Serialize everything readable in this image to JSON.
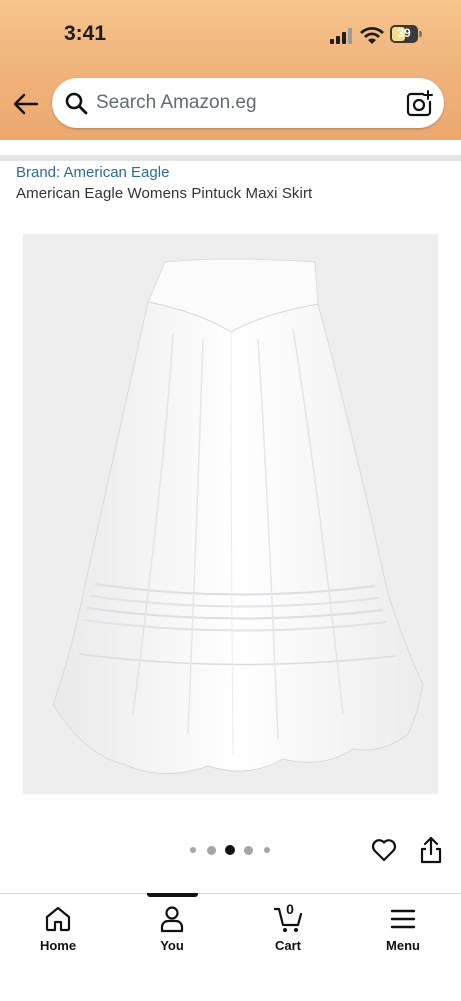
{
  "status_bar": {
    "time": "3:41",
    "battery_level": "39"
  },
  "search": {
    "placeholder": "Search Amazon.eg"
  },
  "product": {
    "brand_link": "Brand: American Eagle",
    "title": "American Eagle Womens Pintuck Maxi Skirt"
  },
  "gallery": {
    "image_count": 5,
    "active_index": 2
  },
  "bottom_nav": {
    "items": [
      {
        "label": "Home",
        "icon": "home-icon"
      },
      {
        "label": "You",
        "icon": "person-icon"
      },
      {
        "label": "Cart",
        "icon": "cart-icon",
        "count": "0"
      },
      {
        "label": "Menu",
        "icon": "menu-icon"
      }
    ],
    "active_index": 1
  },
  "colors": {
    "header": "#f0b27a",
    "link": "#2f6b91",
    "text": "#0f1111"
  }
}
